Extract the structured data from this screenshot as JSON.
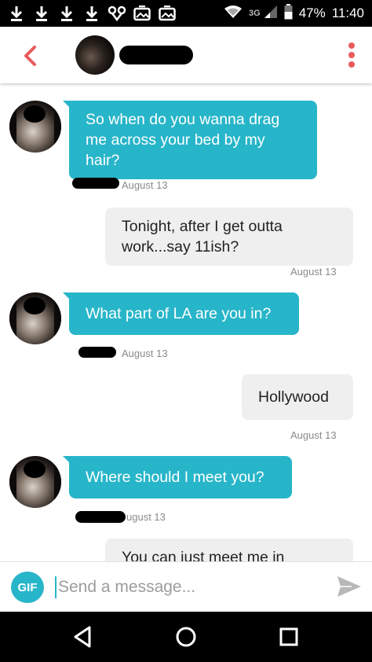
{
  "status_bar": {
    "network": "3G",
    "battery": "47%",
    "time": "11:40",
    "left_icons": [
      "download-icon",
      "download-icon",
      "download-icon",
      "download-icon",
      "voicemail-icon",
      "photo-icon",
      "photo-icon"
    ]
  },
  "header": {
    "back_icon": "chevron-left-icon",
    "more_icon": "more-vertical-icon"
  },
  "messages": [
    {
      "direction": "incoming",
      "text": "So when do you wanna drag me across your bed by my hair?",
      "time": "August 13"
    },
    {
      "direction": "outgoing",
      "text": "Tonight, after I get outta work...say 11ish?",
      "time": "August 13"
    },
    {
      "direction": "incoming",
      "text": "What part of LA are you in?",
      "time": "August 13"
    },
    {
      "direction": "outgoing",
      "text": "Hollywood",
      "time": "August 13"
    },
    {
      "direction": "incoming",
      "text": "Where should I meet you?",
      "time": "ugust 13"
    },
    {
      "direction": "outgoing",
      "text": "You can just meet me in"
    }
  ],
  "composer": {
    "gif_label": "GIF",
    "placeholder": "Send a message...",
    "send_icon": "send-icon"
  },
  "colors": {
    "accent": "#27b5c9",
    "brand_red": "#e95b5b",
    "outgoing_bubble": "#efefef"
  }
}
